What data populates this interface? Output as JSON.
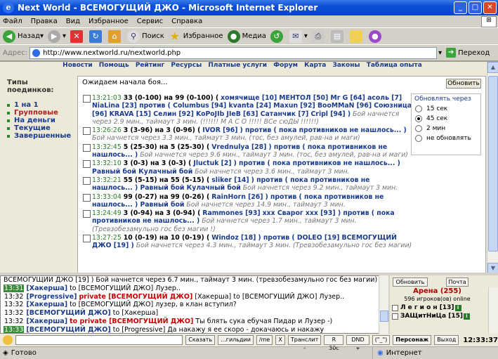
{
  "window": {
    "title": "Next World - ВСЕМОГУЩИЙ ДЖО - Microsoft Internet Explorer"
  },
  "menu": [
    "Файл",
    "Правка",
    "Вид",
    "Избранное",
    "Сервис",
    "Справка"
  ],
  "toolbar": {
    "back": "Назад",
    "search": "Поиск",
    "favorites": "Избранное",
    "media": "Медиа"
  },
  "address": {
    "label": "Адрес:",
    "url": "http://www.nextworld.ru/nextworld.php",
    "go": "Переход"
  },
  "nav": [
    "Новости",
    "Помощь",
    "Рейтинг",
    "Ресурсы",
    "Платные услуги",
    "Форум",
    "Карта",
    "Законы",
    "Таблица опыта"
  ],
  "fight_types": {
    "heading": "Типы поединков:",
    "items": [
      "1 на 1",
      "Групповые",
      "На деньги",
      "Текущие",
      "Завершенные"
    ]
  },
  "panel": {
    "waiting": "Ожидаем начала боя...",
    "refresh": "Обновить"
  },
  "update": {
    "title": "Обновлять через",
    "options": [
      "15 сек",
      "45 сек",
      "2 мин",
      "не обновлять"
    ],
    "selected": 1
  },
  "fights": [
    {
      "time": "13:21:03",
      "text1": "33 (0-100) на 99 (0-100) (",
      "p1": "хомячище [10]",
      "rest": "МЕНТОЛ [50] Mr G [64] асоль [7] NiaLina [23] против ( Columbus [94] kvanta [24] Maxun [92] BooMMaN [96] Союзница [96] KRAVA [15] Селин [92] KoPoJIb JIeB [63] Сатанчик [7] Cripl [94] )",
      "note": "Бой начнется через 2.9 мин., таймаут 3 мин. (!!!!!! M A C O !!!!! ВСе сюДЫ !!!!!!)"
    },
    {
      "time": "13:26:26",
      "text1": "3 (3-96) на 3 (0-96) (",
      "p1": "IVOR [96]",
      "rest": ") против ( пока противников не нашлось... )",
      "note": "Бой начнется через 3.3 мин., таймаут 3 мин. (тос, без амулей, рав-на и маги)"
    },
    {
      "time": "13:32:45",
      "text1": "5 (25-30) на 5 (25-30) (",
      "p1": "Vrednulya [28]",
      "rest": ") против ( пока противников не нашлось... )",
      "note": "Бой начнется через 9.6 мин., таймаут 3 мин. (тос, без амулей, рав-на и маги)"
    },
    {
      "time": "13:32:10",
      "text1": "3 (0-3) на 3 (0-3) (",
      "p1": "Jluctuk [2]",
      "rest": ") против ( пока противников не нашлось... ) Равный бой Кулачный бой",
      "note": "Бой начнется через 3.6 мин., таймаут 3 мин."
    },
    {
      "time": "13:32:21",
      "text1": "55 (5-15) на 55 (5-15) (",
      "p1": "sliker [14]",
      "rest": ") против ( пока противников не нашлось... ) Равный бой Кулачный бой",
      "note": "Бой начнется через 9.2 мин., таймаут 3 мин."
    },
    {
      "time": "13:33:04",
      "text1": "99 (0-27) на 99 (0-26) (",
      "p1": "RainHorn [26]",
      "rest": ") против ( пока противников не нашлось... ) Равный бой",
      "note": "Бой начнется через 14.9 мин., таймаут 3 мин."
    },
    {
      "time": "13:24:49",
      "text1": "3 (0-94) на 3 (0-94) (",
      "p1": "Rammones [93]",
      "rest": "ххх Сварог ххх [93] ) против ( пока противников не нашлось... )",
      "note": "Бой начнется через 1.7 мин., таймаут 3 мин. (Тревзобезамульно гос без магии !)"
    },
    {
      "time": "13:27:25",
      "text1": "10 (0-19) на 10 (0-19) (",
      "p1": "Windoz [18]",
      "rest": ") против ( DOLEO [19] ВСЕМОГУЩИЙ ДЖО [19] )",
      "note": "Бой начнется через 4.3 мин., таймаут 3 мин. (Тревзобезамульно гос без магии)"
    }
  ],
  "chat": [
    {
      "time": "",
      "text": "ВСЕМОГУЩИЙ ДЖО [19] ) Бой начнется через 6.7 мин., таймаут 3 мин. (тревзобезамульно гос без магии)"
    },
    {
      "time": "13:31",
      "nick": "[Хакерша]",
      "text": "to [ВСЕМОГУЩИЙ ДЖО] Лузер.."
    },
    {
      "time": "13:32",
      "nick": "[Progressive]",
      "private": "private [ВСЕМОГУЩИЙ ДЖО]",
      "text": "[Хакерша] to [ВСЕМОГУЩИЙ ДЖО] Лузер.."
    },
    {
      "time": "13:32",
      "nick": "[Хакерша]",
      "text": "to [ВСЕМОГУЩИЙ ДЖО] лузер, в клан вступил?"
    },
    {
      "time": "13:32",
      "nick": "[ВСЕМОГУЩИЙ ДЖО]",
      "text": "to [Хакерша]"
    },
    {
      "time": "13:32",
      "nick": "[Хакерша]",
      "private": "to private [ВСЕМОГУЩИЙ ДЖО]",
      "text": "Ты блять сука ебучая Пидар и Лузер -)"
    },
    {
      "time": "13:33",
      "nick": "[ВСЕМОГУЩИЙ ДЖО]",
      "text": "to [Progressive] Да накажу я ее скоро - докачаюсь и накажу"
    }
  ],
  "side": {
    "refresh": "Обновить",
    "mail": "Почта",
    "arena": "Арена (255)",
    "online": "596 игроков(ов) online",
    "players": [
      "Л е г и о н [13]",
      "ЗАЩитНиЦа [15]"
    ]
  },
  "inputbar": {
    "say": "Сказать",
    "buttons": [
      "...гильдии",
      "/me",
      "X",
      "Транслит -",
      "R 30c",
      "DND +",
      "(\"_\")",
      "Персонаж",
      "Выход"
    ],
    "clock": "12:33:37"
  },
  "status": {
    "done": "Готово",
    "zone": "Интернет"
  }
}
